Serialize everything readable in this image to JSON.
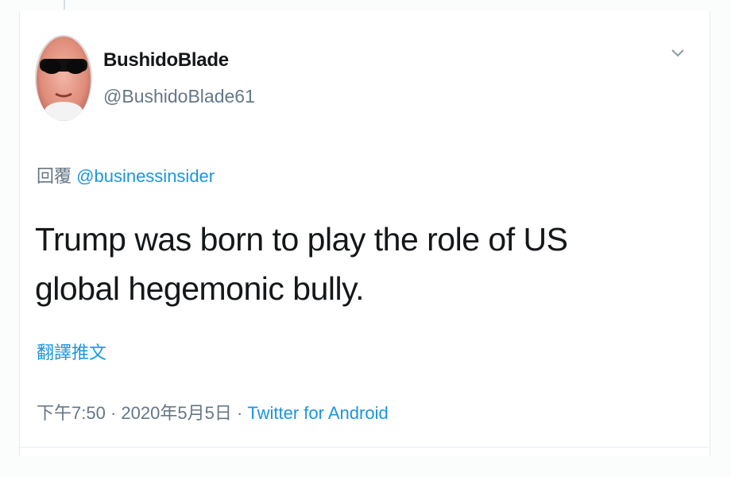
{
  "tweet": {
    "display_name": "BushidoBlade",
    "handle": "@BushidoBlade61",
    "reply_prefix": "回覆",
    "reply_mention": "@businessinsider",
    "text": "Trump was born to play the role of US global hegemonic bully.",
    "translate_label": "翻譯推文",
    "time": "下午7:50",
    "separator": "·",
    "date": "2020年5月5日",
    "source": "Twitter for Android",
    "menu_icon": "chevron-down-icon",
    "avatar_icon": "avatar"
  },
  "colors": {
    "link": "#1b95e0",
    "secondary": "#657786",
    "text": "#14171a",
    "border": "#e6ecf0"
  }
}
